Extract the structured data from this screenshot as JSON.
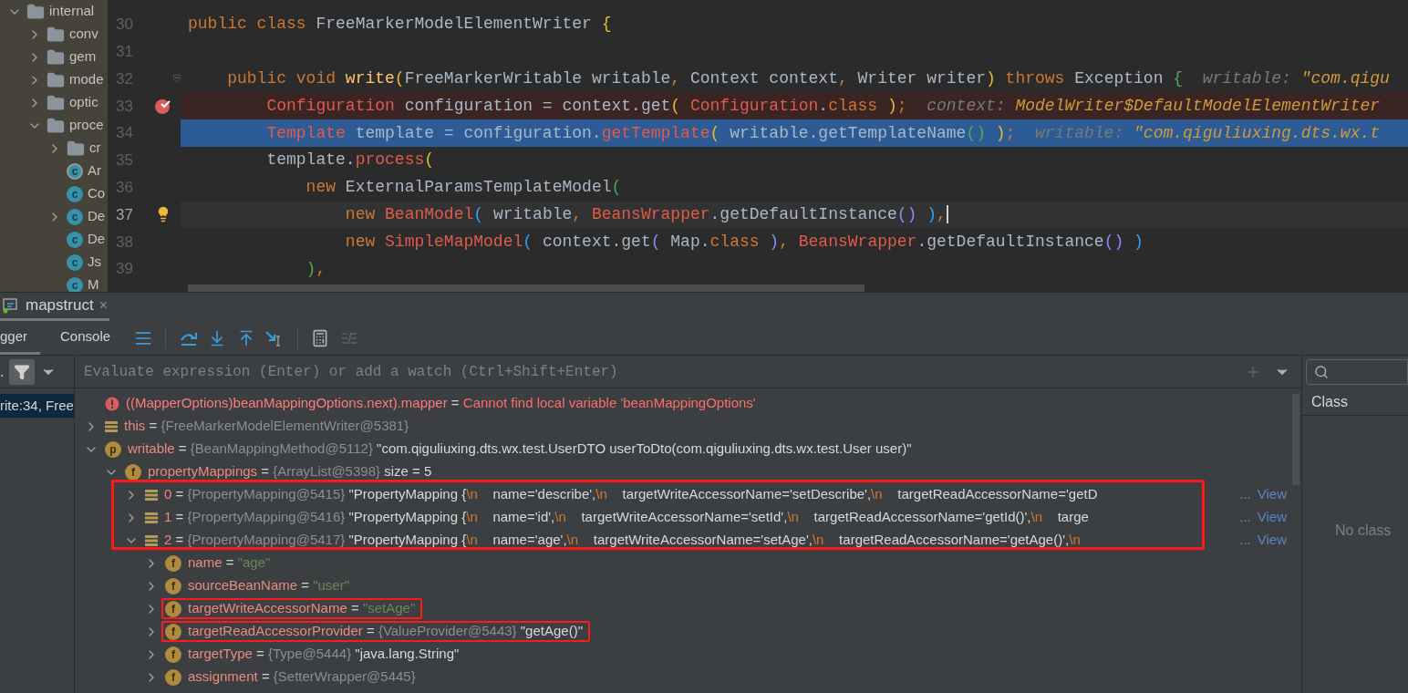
{
  "project_tree": [
    {
      "label": "internal",
      "kind": "folder",
      "expanded": true,
      "children": [
        {
          "label": "conv",
          "kind": "folder",
          "expanded": false
        },
        {
          "label": "gem",
          "kind": "folder",
          "expanded": false
        },
        {
          "label": "mode",
          "kind": "folder",
          "expanded": false
        },
        {
          "label": "optic",
          "kind": "folder",
          "expanded": false
        },
        {
          "label": "proce",
          "kind": "folder",
          "expanded": true,
          "children": [
            {
              "label": "cr",
              "kind": "folder",
              "expanded": false
            },
            {
              "label": "Ar",
              "kind": "abstract-class",
              "badge": "c"
            },
            {
              "label": "Co",
              "kind": "class",
              "badge": "c"
            },
            {
              "label": "De",
              "kind": "class",
              "badge": "c",
              "expanded": false
            },
            {
              "label": "De",
              "kind": "class",
              "badge": "c"
            },
            {
              "label": "Js",
              "kind": "class",
              "badge": "c"
            },
            {
              "label": "M",
              "kind": "class",
              "badge": "c"
            }
          ]
        }
      ]
    }
  ],
  "editor": {
    "lines": [
      {
        "number": "30",
        "tokens": [
          {
            "text": "public class",
            "kind": "kw"
          },
          {
            "text": " FreeMarkerModelElementWriter ",
            "kind": "plain"
          },
          {
            "text": "{",
            "kind": "y"
          }
        ]
      },
      {
        "number": "31"
      },
      {
        "number": "32",
        "fold": true,
        "tokens": [
          {
            "text": "    public void ",
            "kind": "kw"
          },
          {
            "text": "write",
            "kind": "fn"
          },
          {
            "text": "(",
            "kind": "y"
          },
          {
            "text": "FreeMarkerWritable writable",
            "kind": "plain"
          },
          {
            "text": ",",
            "kind": "kw"
          },
          {
            "text": " Context context",
            "kind": "plain"
          },
          {
            "text": ",",
            "kind": "kw"
          },
          {
            "text": " Writer writer",
            "kind": "plain"
          },
          {
            "text": ")",
            "kind": "y"
          },
          {
            "text": " throws",
            "kind": "kw"
          },
          {
            "text": " Exception ",
            "kind": "plain"
          },
          {
            "text": "{",
            "kind": "g"
          },
          {
            "text": "  writable: ",
            "kind": "hl"
          },
          {
            "text": "\"com.qigu",
            "kind": "hv"
          }
        ]
      },
      {
        "number": "33",
        "breakpoint": true,
        "tokens": [
          {
            "text": "        Configuration",
            "kind": "err"
          },
          {
            "text": " configuration = context.get",
            "kind": "plain"
          },
          {
            "text": "(",
            "kind": "y"
          },
          {
            "text": " Configuration",
            "kind": "err"
          },
          {
            "text": ".",
            "kind": "plain"
          },
          {
            "text": "class",
            "kind": "kw"
          },
          {
            "text": " )",
            "kind": "y"
          },
          {
            "text": ";",
            "kind": "kw"
          },
          {
            "text": "  context: ",
            "kind": "hl"
          },
          {
            "text": "ModelWriter$DefaultModelElementWriter",
            "kind": "hv"
          }
        ]
      },
      {
        "number": "34",
        "execution": true,
        "tokens": [
          {
            "text": "        Template",
            "kind": "err"
          },
          {
            "text": " template = configuration.",
            "kind": "plain"
          },
          {
            "text": "getTemplate",
            "kind": "err"
          },
          {
            "text": "(",
            "kind": "y"
          },
          {
            "text": " writable.getTemplateName",
            "kind": "plain"
          },
          {
            "text": "()",
            "kind": "g"
          },
          {
            "text": " )",
            "kind": "y"
          },
          {
            "text": ";",
            "kind": "kw"
          },
          {
            "text": "  writable: ",
            "kind": "hl"
          },
          {
            "text": "\"com.qiguliuxing.dts.wx.t",
            "kind": "hv"
          }
        ]
      },
      {
        "number": "35",
        "tokens": [
          {
            "text": "        template.",
            "kind": "plain"
          },
          {
            "text": "process",
            "kind": "err"
          },
          {
            "text": "(",
            "kind": "y"
          }
        ]
      },
      {
        "number": "36",
        "tokens": [
          {
            "text": "            new",
            "kind": "kw"
          },
          {
            "text": " ExternalParamsTemplateModel",
            "kind": "plain"
          },
          {
            "text": "(",
            "kind": "g"
          }
        ]
      },
      {
        "number": "37",
        "caret_line": true,
        "bulb": true,
        "caret": true,
        "tokens": [
          {
            "text": "                new",
            "kind": "kw"
          },
          {
            "text": " BeanModel",
            "kind": "err"
          },
          {
            "text": "(",
            "kind": "b"
          },
          {
            "text": " writable",
            "kind": "plain"
          },
          {
            "text": ",",
            "kind": "kw"
          },
          {
            "text": " BeansWrapper",
            "kind": "err"
          },
          {
            "text": ".getDefaultInstance",
            "kind": "plain"
          },
          {
            "text": "()",
            "kind": "p"
          },
          {
            "text": " )",
            "kind": "b"
          },
          {
            "text": ",",
            "kind": "kw"
          }
        ]
      },
      {
        "number": "38",
        "tokens": [
          {
            "text": "                new",
            "kind": "kw"
          },
          {
            "text": " SimpleMapModel",
            "kind": "err"
          },
          {
            "text": "(",
            "kind": "b"
          },
          {
            "text": " context.get",
            "kind": "plain"
          },
          {
            "text": "(",
            "kind": "p"
          },
          {
            "text": " Map.",
            "kind": "plain"
          },
          {
            "text": "class",
            "kind": "kw"
          },
          {
            "text": " )",
            "kind": "p"
          },
          {
            "text": ",",
            "kind": "kw"
          },
          {
            "text": " BeansWrapper",
            "kind": "err"
          },
          {
            "text": ".getDefaultInstance",
            "kind": "plain"
          },
          {
            "text": "()",
            "kind": "p"
          },
          {
            "text": " )",
            "kind": "b"
          }
        ]
      },
      {
        "number": "39",
        "tokens": [
          {
            "text": "            )",
            "kind": "g"
          },
          {
            "text": ",",
            "kind": "kw"
          }
        ]
      }
    ]
  },
  "debug": {
    "session": {
      "label": "mapstruct",
      "close": "×"
    },
    "tabs": [
      {
        "label": "gger",
        "selected": true
      },
      {
        "label": "Console",
        "selected": false
      }
    ],
    "frames": {
      "label": ".",
      "filter_on": true,
      "items": [
        {
          "label": "rite:34, Free",
          "selected": true
        }
      ]
    },
    "evaluate": {
      "placeholder": "Evaluate expression (Enter) or add a watch (Ctrl+Shift+Enter)"
    },
    "variables": [
      {
        "kind": "error",
        "name": "((MapperOptions)beanMappingOptions.next).mapper",
        "eq": "=",
        "error": "Cannot find local variable 'beanMappingOptions'"
      },
      {
        "kind": "object",
        "name": "this",
        "eq": "=",
        "ref": "{FreeMarkerModelElementWriter@5381}",
        "expanded": false
      },
      {
        "kind": "param",
        "badge": "p",
        "name": "writable",
        "eq": "=",
        "ref": "{BeanMappingMethod@5112}",
        "value": "\"com.qiguliuxing.dts.wx.test.UserDTO userToDto(com.qiguliuxing.dts.wx.test.User user)\"",
        "expanded": true,
        "children": [
          {
            "kind": "field",
            "badge": "f",
            "name": "propertyMappings",
            "eq": "=",
            "ref": "{ArrayList@5398}",
            "value": "size = 5",
            "expanded": true,
            "children": [
              {
                "kind": "object",
                "group_boxed": true,
                "name": "0",
                "eq": "=",
                "ref": "{PropertyMapping@5415}",
                "value_parts": [
                  {
                    "text": "\"PropertyMapping {",
                    "kind": "text"
                  },
                  {
                    "text": "\\n",
                    "kind": "escape"
                  },
                  {
                    "text": "    name='describe',",
                    "kind": "text"
                  },
                  {
                    "text": "\\n",
                    "kind": "escape"
                  },
                  {
                    "text": "    targetWriteAccessorName='setDescribe',",
                    "kind": "text"
                  },
                  {
                    "text": "\\n",
                    "kind": "escape"
                  },
                  {
                    "text": "    targetReadAccessorName='getD",
                    "kind": "text"
                  }
                ],
                "ellipsis": "...",
                "link": "View",
                "expanded": false
              },
              {
                "kind": "object",
                "group_boxed": true,
                "name": "1",
                "eq": "=",
                "ref": "{PropertyMapping@5416}",
                "value_parts": [
                  {
                    "text": "\"PropertyMapping {",
                    "kind": "text"
                  },
                  {
                    "text": "\\n",
                    "kind": "escape"
                  },
                  {
                    "text": "    name='id',",
                    "kind": "text"
                  },
                  {
                    "text": "\\n",
                    "kind": "escape"
                  },
                  {
                    "text": "    targetWriteAccessorName='setId',",
                    "kind": "text"
                  },
                  {
                    "text": "\\n",
                    "kind": "escape"
                  },
                  {
                    "text": "    targetReadAccessorName='getId()',",
                    "kind": "text"
                  },
                  {
                    "text": "\\n",
                    "kind": "escape"
                  },
                  {
                    "text": "    targe",
                    "kind": "text"
                  }
                ],
                "ellipsis": "...",
                "link": "View",
                "expanded": false
              },
              {
                "kind": "object",
                "group_boxed": true,
                "name": "2",
                "eq": "=",
                "ref": "{PropertyMapping@5417}",
                "value_parts": [
                  {
                    "text": "\"PropertyMapping {",
                    "kind": "text"
                  },
                  {
                    "text": "\\n",
                    "kind": "escape"
                  },
                  {
                    "text": "    name='age',",
                    "kind": "text"
                  },
                  {
                    "text": "\\n",
                    "kind": "escape"
                  },
                  {
                    "text": "    targetWriteAccessorName='setAge',",
                    "kind": "text"
                  },
                  {
                    "text": "\\n",
                    "kind": "escape"
                  },
                  {
                    "text": "    targetReadAccessorName='getAge()',",
                    "kind": "text"
                  },
                  {
                    "text": "\\n",
                    "kind": "escape"
                  }
                ],
                "ellipsis": "...",
                "link": "View",
                "expanded": true,
                "children": [
                  {
                    "kind": "field",
                    "badge": "f",
                    "name": "name",
                    "eq": "=",
                    "string": "\"age\"",
                    "expanded": false
                  },
                  {
                    "kind": "field",
                    "badge": "f",
                    "name": "sourceBeanName",
                    "eq": "=",
                    "string": "\"user\"",
                    "expanded": false
                  },
                  {
                    "kind": "field",
                    "badge": "f",
                    "boxed": true,
                    "name": "targetWriteAccessorName",
                    "eq": "=",
                    "string": "\"setAge\"",
                    "expanded": false
                  },
                  {
                    "kind": "field",
                    "badge": "f",
                    "boxed": true,
                    "name": "targetReadAccessorProvider",
                    "eq": "=",
                    "ref": "{ValueProvider@5443}",
                    "value": "\"getAge()\"",
                    "expanded": false
                  },
                  {
                    "kind": "field",
                    "badge": "f",
                    "name": "targetType",
                    "eq": "=",
                    "ref": "{Type@5444}",
                    "value": "\"java.lang.String\"",
                    "expanded": false
                  },
                  {
                    "kind": "field",
                    "badge": "f",
                    "name": "assignment",
                    "eq": "=",
                    "ref": "{SetterWrapper@5445}",
                    "expanded": false
                  }
                ]
              }
            ]
          }
        ]
      }
    ],
    "classes": {
      "column": "Class",
      "empty": "No class"
    }
  }
}
